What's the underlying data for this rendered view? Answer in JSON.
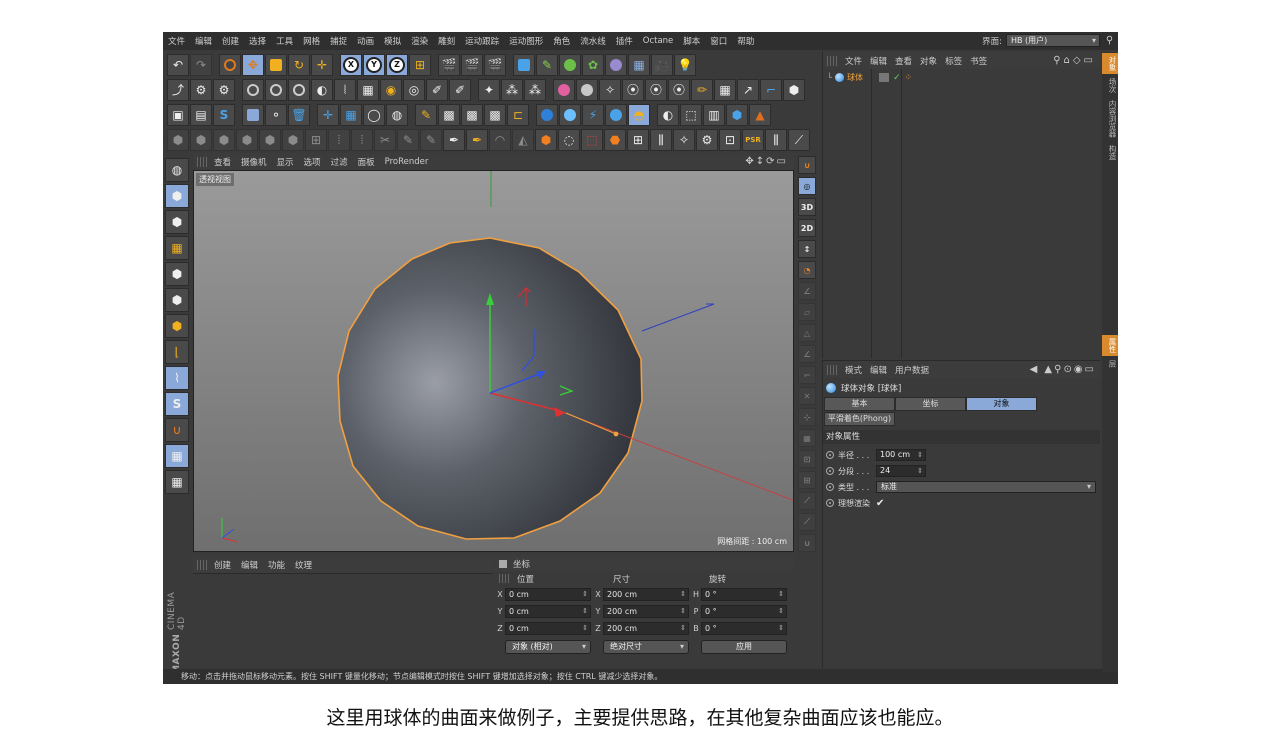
{
  "menu": [
    "文件",
    "编辑",
    "创建",
    "选择",
    "工具",
    "网格",
    "捕捉",
    "动画",
    "模拟",
    "渲染",
    "雕刻",
    "运动跟踪",
    "运动图形",
    "角色",
    "流水线",
    "插件",
    "Octane",
    "脚本",
    "窗口",
    "帮助"
  ],
  "interface": {
    "label": "界面:",
    "value": "HB (用户)"
  },
  "viewport": {
    "menu": [
      "查看",
      "摄像机",
      "显示",
      "选项",
      "过滤",
      "面板",
      "ProRender"
    ],
    "label": "透视视图",
    "grid_spacing": "网格间距 : 100 cm"
  },
  "viewport_side": {
    "btn_3d": "3D",
    "btn_2d": "2D"
  },
  "material_manager": {
    "menu": [
      "创建",
      "编辑",
      "功能",
      "纹理"
    ]
  },
  "coordinates": {
    "title": "坐标",
    "col_position": "位置",
    "col_size": "尺寸",
    "col_rotation": "旋转",
    "rows": [
      {
        "pos_axis": "X",
        "pos": "0 cm",
        "size_axis": "X",
        "size": "200 cm",
        "rot_axis": "H",
        "rot": "0 °"
      },
      {
        "pos_axis": "Y",
        "pos": "0 cm",
        "size_axis": "Y",
        "size": "200 cm",
        "rot_axis": "P",
        "rot": "0 °"
      },
      {
        "pos_axis": "Z",
        "pos": "0 cm",
        "size_axis": "Z",
        "size": "200 cm",
        "rot_axis": "B",
        "rot": "0 °"
      }
    ],
    "mode_select": "对象 (相对)",
    "size_select": "绝对尺寸",
    "apply": "应用"
  },
  "status_bar": "移动：点击并拖动鼠标移动元素。按住 SHIFT 键量化移动；节点编辑模式时按住 SHIFT 键增加选择对象；按住 CTRL 键减少选择对象。",
  "brand": {
    "maxon": "MAXON",
    "product": "CINEMA 4D"
  },
  "object_manager": {
    "menu": [
      "文件",
      "编辑",
      "查看",
      "对象",
      "标签",
      "书签"
    ],
    "objects": [
      {
        "name": "球体"
      }
    ]
  },
  "side_tabs_top": [
    "对象",
    "场次",
    "内容浏览器",
    "构造"
  ],
  "side_tabs_bottom": [
    "属性",
    "层"
  ],
  "attributes": {
    "menu": [
      "模式",
      "编辑",
      "用户数据"
    ],
    "object_title": "球体对象 [球体]",
    "tabs": [
      "基本",
      "坐标",
      "对象"
    ],
    "active_tab": "对象",
    "phong_tab": "平滑着色(Phong)",
    "section": "对象属性",
    "radius_label": "半径 . . .",
    "radius": "100 cm",
    "segments_label": "分段 . . .",
    "segments": "24",
    "type_label": "类型 . . .",
    "type": "标准",
    "ideal_render_label": "理想渲染",
    "ideal_render": "✔"
  },
  "caption": "这里用球体的曲面来做例子，主要提供思路，在其他复杂曲面应该也能应。",
  "colors": {
    "accent_orange": "#d98a2c",
    "tool_active": "#8aa8d8",
    "sphere_highlight": "#f0a040"
  }
}
